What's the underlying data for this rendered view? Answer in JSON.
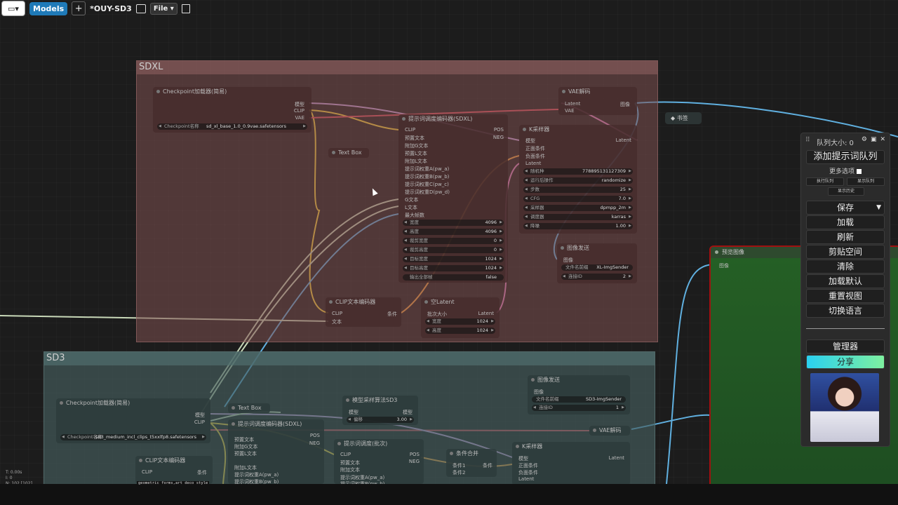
{
  "topbar": {
    "models_label": "Models",
    "add_label": "+",
    "workflow_title": "*OUY-SD3",
    "file_label": "File"
  },
  "groups": {
    "sdxl_title": "SDXL",
    "sd3_title": "SD3"
  },
  "sdxl": {
    "checkpoint": {
      "title": "Checkpoint加载器(简易)",
      "out_model": "模型",
      "out_clip": "CLIP",
      "out_vae": "VAE",
      "w_key": "Checkpoint名称",
      "w_val": "sd_xl_base_1.0_0.9vae.safetensors"
    },
    "textbox": {
      "title": "Text Box"
    },
    "encoder": {
      "title": "提示词调度编码器(SDXL)",
      "in_clip": "CLIP",
      "in_t1": "预置文本",
      "in_t2": "附加G文本",
      "in_t3": "预置L文本",
      "in_t4": "附加L文本",
      "in_t5": "提示词权重A(pw_a)",
      "in_t6": "提示词权重B(pw_b)",
      "in_t7": "提示词权重C(pw_c)",
      "in_t8": "提示词权重D(pw_d)",
      "in_g": "G文本",
      "in_l": "L文本",
      "in_f": "最大帧数",
      "out_pos": "POS",
      "out_neg": "NEG",
      "w_width_k": "宽度",
      "w_width_v": "4096",
      "w_height_k": "高度",
      "w_height_v": "4096",
      "w_cropw_k": "裁剪宽度",
      "w_cropw_v": "0",
      "w_croph_k": "裁剪高度",
      "w_croph_v": "0",
      "w_tw_k": "目标宽度",
      "w_tw_v": "1024",
      "w_th_k": "目标高度",
      "w_th_v": "1024",
      "w_last_k": "输出全部帧",
      "w_last_v": "false"
    },
    "vae": {
      "title": "VAE解码",
      "in_latent": "Latent",
      "in_vae": "VAE",
      "out_img": "图像"
    },
    "ksampler": {
      "title": "K采样器",
      "in_model": "模型",
      "in_pos": "正面条件",
      "in_neg": "负面条件",
      "in_latent": "Latent",
      "out_latent": "Latent",
      "w_seed_k": "随机种",
      "w_seed_v": "778895131127309",
      "w_ctrl_k": "运行后操作",
      "w_ctrl_v": "randomize",
      "w_steps_k": "步数",
      "w_steps_v": "25",
      "w_cfg_k": "CFG",
      "w_cfg_v": "7.0",
      "w_sampler_k": "采样器",
      "w_sampler_v": "dpmpp_2m",
      "w_sched_k": "调度器",
      "w_sched_v": "karras",
      "w_denoise_k": "降噪",
      "w_denoise_v": "1.00"
    },
    "sender": {
      "title": "图像发送",
      "in_img": "图像",
      "w_prefix_k": "文件名前缀",
      "w_prefix_v": "XL-ImgSender",
      "w_link_k": "连接ID",
      "w_link_v": "2"
    },
    "clipenc": {
      "title": "CLIP文本编码器",
      "in_clip": "CLIP",
      "in_text": "文本",
      "out_cond": "条件"
    },
    "latent": {
      "title": "空Latent",
      "in_batch": "批次大小",
      "out_latent": "Latent",
      "w_w_k": "宽度",
      "w_w_v": "1024",
      "w_h_k": "高度",
      "w_h_v": "1024"
    }
  },
  "sd3": {
    "checkpoint": {
      "title": "Checkpoint加载器(简易)",
      "out_model": "模型",
      "out_clip": "CLIP",
      "w_key": "Checkpoint名称",
      "w_val": "sd3_medium_incl_clips_t5xxlfp8.safetensors"
    },
    "textbox": {
      "title": "Text Box"
    },
    "encoder": {
      "title": "提示词调度编码器(SDXL)",
      "pos": "POS",
      "neg": "NEG",
      "t1": "预置文本",
      "t2": "附加G文本",
      "t3": "预置L文本",
      "t4": "附加L文本",
      "t5": "提示词权重A(pw_a)",
      "t6": "提示词权重B(pw_b)"
    },
    "modelsample": {
      "title": "模型采样算法SD3",
      "in_model": "模型",
      "out_model": "模型",
      "w_k": "偏移",
      "w_v": "3.00"
    },
    "sched": {
      "title": "提示词调度(批次)",
      "clip": "CLIP",
      "pos": "POS",
      "neg": "NEG",
      "t1": "预置文本",
      "t2": "附加文本",
      "t3": "提示词权重A(pw_a)",
      "t4": "提示词权重B(pw_b)"
    },
    "combine": {
      "title": "条件合并",
      "in1": "条件1",
      "in2": "条件2",
      "out": "条件"
    },
    "ksampler": {
      "title": "K采样器",
      "in_model": "模型",
      "in_pos": "正面条件",
      "in_neg": "负面条件",
      "in_latent": "Latent",
      "out_latent": "Latent"
    },
    "sender": {
      "title": "图像发送",
      "in_img": "图像",
      "w_prefix_k": "文件名前缀",
      "w_prefix_v": "SD3-ImgSender",
      "w_link_k": "连接ID",
      "w_link_v": "1"
    },
    "vae": {
      "title": "VAE解码"
    },
    "clipenc": {
      "title": "CLIP文本编码器",
      "in_clip": "CLIP",
      "out": "条件"
    }
  },
  "bookmark": {
    "label": "书签"
  },
  "preview": {
    "title": "预览图像",
    "in_img": "图像"
  },
  "panel": {
    "queue_size": "队列大小: 0",
    "add_prompt_queue": "添加提示词队列",
    "more_options": "更多选项",
    "exec_queue": "执行队列",
    "show_queue": "显示队列",
    "show_history": "显示历史",
    "save": "保存",
    "load": "加载",
    "refresh": "刷新",
    "clipspace": "剪贴空间",
    "clear": "清除",
    "load_default": "加载默认",
    "reset_view": "重置视图",
    "switch_lang": "切换语言",
    "manager": "管理器",
    "share": "分享"
  },
  "stats": {
    "line1": "T: 0.00s",
    "line2": "I: 0",
    "line3": "N: 102 [102]"
  },
  "prompt_snippet": "geometric forms,art deco style",
  "colors": {
    "clip": "#f5d03a",
    "model": "#c9a0dc",
    "vae": "#e05060",
    "latent": "#e080c0",
    "cond": "#f0a040",
    "image": "#60b0e0",
    "text": "#c8d8b8",
    "preview_border": "#a01010",
    "models_btn": "#1f7ab8"
  }
}
